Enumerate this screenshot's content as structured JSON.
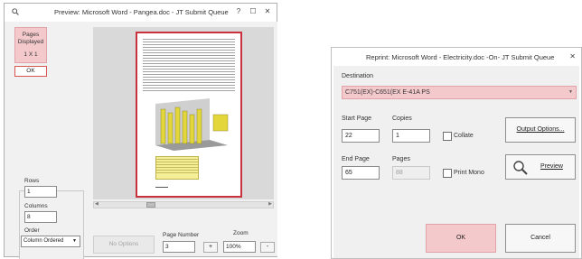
{
  "preview_dialog": {
    "title": "Preview:  Microsoft Word - Pangea.doc  - JT Submit Queue",
    "help_label": "?",
    "maximize_label": "☐",
    "close_label": "✕",
    "pages_displayed_label": "Pages Displayed",
    "pages_displayed_value": "1 X 1",
    "ok_label": "OK",
    "rows_label": "Rows",
    "rows_value": "1",
    "columns_label": "Columns",
    "columns_value": "8",
    "order_label": "Order",
    "order_value": "Column Ordered",
    "no_options_label": "No Options",
    "page_number_label": "Page Number",
    "page_number_value": "3",
    "page_plus_label": "+",
    "zoom_label": "Zoom",
    "zoom_value": "100%",
    "zoom_minus_label": "-"
  },
  "reprint_dialog": {
    "title": "Reprint:  Microsoft Word - Electricity.doc  -On-  JT Submit Queue",
    "close_label": "✕",
    "destination_label": "Destination",
    "destination_value": "C751(EX)-C651(EX E-41A PS",
    "start_page_label": "Start Page",
    "start_page_value": "22",
    "copies_label": "Copies",
    "copies_value": "1",
    "collate_label": "Collate",
    "collate_checked": false,
    "output_options_label": "Output Options...",
    "end_page_label": "End Page",
    "end_page_value": "65",
    "pages_label": "Pages",
    "pages_value": "88",
    "print_mono_label": "Print Mono",
    "print_mono_checked": false,
    "preview_label": "Preview",
    "ok_label": "OK",
    "cancel_label": "Cancel"
  },
  "icons": {
    "preview_app": "magnifier-icon",
    "preview_button": "magnifier-icon",
    "dropdown": "chevron-down-icon"
  },
  "colors": {
    "accent_fill": "#f4c9cc",
    "accent_border": "#d9534f",
    "page_border": "#c9313f",
    "chart_bar": "#e3d63a"
  }
}
